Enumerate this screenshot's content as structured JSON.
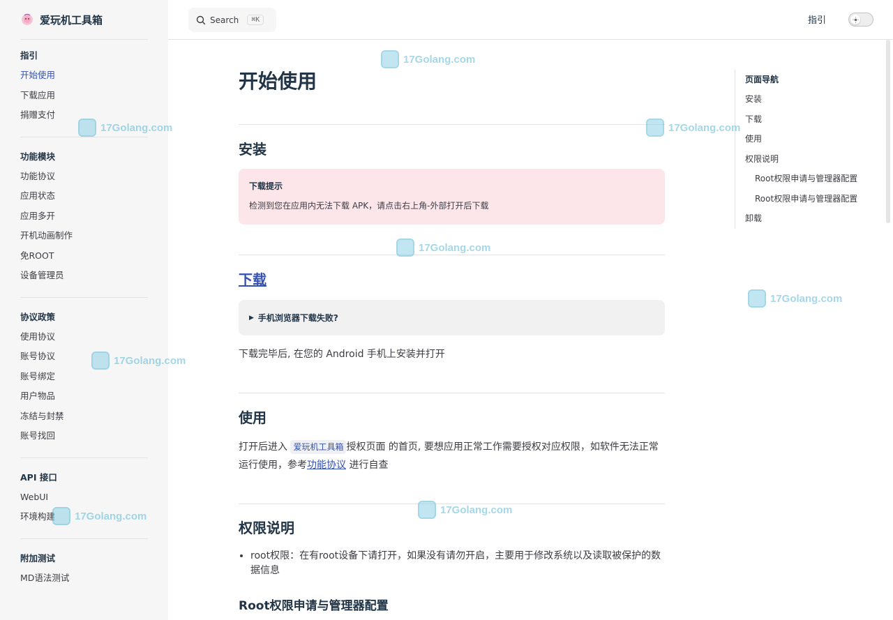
{
  "brand": {
    "name": "爱玩机工具箱"
  },
  "search": {
    "label": "Search",
    "shortcut": "⌘K"
  },
  "topnav": {
    "link": "指引"
  },
  "sidebar": {
    "groups": [
      {
        "title": "指引",
        "items": [
          "开始使用",
          "下载应用",
          "捐赠支付"
        ]
      },
      {
        "title": "功能模块",
        "items": [
          "功能协议",
          "应用状态",
          "应用多开",
          "开机动画制作",
          "免ROOT",
          "设备管理员"
        ]
      },
      {
        "title": "协议政策",
        "items": [
          "使用协议",
          "账号协议",
          "账号绑定",
          "用户物品",
          "冻结与封禁",
          "账号找回"
        ]
      },
      {
        "title": "API 接口",
        "items": [
          "WebUI",
          "环境构建"
        ]
      },
      {
        "title": "附加测试",
        "items": [
          "MD语法测试"
        ]
      }
    ]
  },
  "main": {
    "title": "开始使用",
    "install": {
      "heading": "安装",
      "tip_title": "下载提示",
      "tip_text": "检测到您在应用内无法下载 APK，请点击右上角-外部打开后下载"
    },
    "download": {
      "heading": "下载",
      "details_summary": "手机浏览器下载失败?",
      "after_text": "下载完毕后, 在您的 Android 手机上安装并打开"
    },
    "usage": {
      "heading": "使用",
      "text_1": "打开后进入",
      "chip": "爱玩机工具箱",
      "text_2": "授权页面 的首页, 要想应用正常工作需要授权对应权限，如软件无法正常运行使用，参考",
      "link": "功能协议",
      "text_3": " 进行自查"
    },
    "permissions": {
      "heading": "权限说明",
      "bullet": "root权限：在有root设备下请打开，如果没有请勿开启，主要用于修改系统以及读取被保护的数据信息",
      "subheading": "Root权限申请与管理器配置"
    }
  },
  "outline": {
    "title": "页面导航",
    "items": [
      {
        "label": "安装",
        "sub": false
      },
      {
        "label": "下载",
        "sub": false
      },
      {
        "label": "使用",
        "sub": false
      },
      {
        "label": "权限说明",
        "sub": false
      },
      {
        "label": "Root权限申请与管理器配置",
        "sub": true
      },
      {
        "label": "Root权限申请与管理器配置",
        "sub": true
      },
      {
        "label": "卸载",
        "sub": false
      }
    ]
  },
  "watermark": {
    "text": "17Golang.com"
  },
  "colors": {
    "brand": "#3451b2",
    "tip_bg": "#fde6e9",
    "sidebar_bg": "#f6f6f7"
  }
}
